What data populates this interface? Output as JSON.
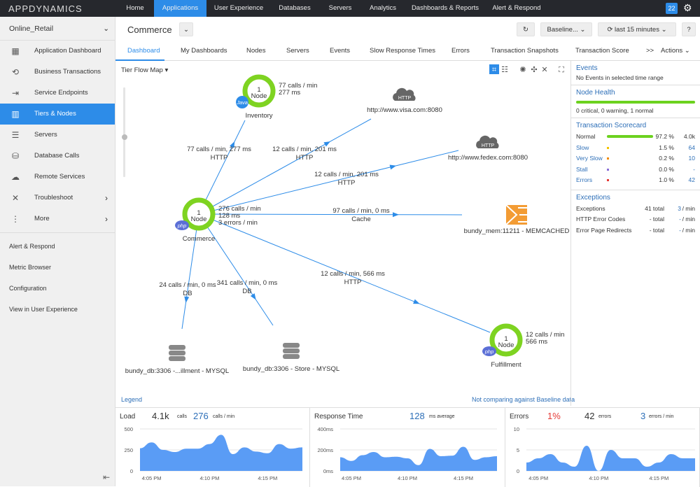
{
  "brand": "APPDYNAMICS",
  "topnav": {
    "items": [
      "Home",
      "Applications",
      "User Experience",
      "Databases",
      "Servers",
      "Analytics",
      "Dashboards & Reports",
      "Alert & Respond"
    ],
    "active": "Applications",
    "badge": "22",
    "accent": "#2d8ce8"
  },
  "sidebar": {
    "app": "Online_Retail",
    "items": [
      {
        "label": "Application Dashboard",
        "icon": "dashboard-icon"
      },
      {
        "label": "Business Transactions",
        "icon": "transactions-icon"
      },
      {
        "label": "Service Endpoints",
        "icon": "endpoint-icon"
      },
      {
        "label": "Tiers & Nodes",
        "icon": "tiers-icon",
        "active": true
      },
      {
        "label": "Servers",
        "icon": "servers-icon"
      },
      {
        "label": "Database Calls",
        "icon": "database-icon"
      },
      {
        "label": "Remote Services",
        "icon": "cloud-icon"
      },
      {
        "label": "Troubleshoot",
        "icon": "tools-icon"
      },
      {
        "label": "More",
        "icon": "more-icon"
      }
    ],
    "links": [
      "Alert & Respond",
      "Metric Browser",
      "Configuration",
      "View in User Experience"
    ]
  },
  "header": {
    "title": "Commerce",
    "baseline": "Baseline...",
    "timerange": "last 15 minutes",
    "help": "?"
  },
  "tabs": [
    "Dashboard",
    "My Dashboards",
    "Nodes",
    "Servers",
    "Events",
    "Slow Response Times",
    "Errors",
    "Transaction Snapshots",
    "Transaction Score"
  ],
  "tabs_more": ">>",
  "actions": "Actions",
  "map": {
    "view": "Tier Flow Map",
    "legend": "Legend",
    "baseline_note": "Not comparing against Baseline data",
    "tiers": [
      {
        "name": "Inventory",
        "count": "1",
        "unit": "Node",
        "agent": "Java",
        "stats": [
          "77 calls / min",
          "277 ms"
        ]
      },
      {
        "name": "Commerce",
        "count": "1",
        "unit": "Node",
        "agent": "php",
        "stats": [
          "276 calls / min",
          "128 ms",
          "3 errors / min"
        ]
      },
      {
        "name": "Fulfillment",
        "count": "1",
        "unit": "Node",
        "agent": "php",
        "stats": [
          "12 calls / min",
          "566 ms"
        ]
      }
    ],
    "backends": [
      {
        "name": "http://www.visa.com:8080",
        "type": "HTTP"
      },
      {
        "name": "http://www.fedex.com:8080",
        "type": "HTTP"
      },
      {
        "name": "bundy_mem:11211 - MEMCACHED",
        "type": "memcached"
      },
      {
        "name": "bundy_db:3306 -...illment - MYSQL",
        "type": "db"
      },
      {
        "name": "bundy_db:3306 - Store - MYSQL",
        "type": "db"
      }
    ],
    "edges": [
      {
        "label": "77 calls / min, 277 ms",
        "proto": "HTTP"
      },
      {
        "label": "12 calls / min, 201 ms",
        "proto": "HTTP"
      },
      {
        "label": "12 calls / min, 201 ms",
        "proto": "HTTP"
      },
      {
        "label": "97 calls / min, 0 ms",
        "proto": "Cache"
      },
      {
        "label": "12 calls / min, 566 ms",
        "proto": "HTTP"
      },
      {
        "label": "24 calls / min, 0 ms",
        "proto": "DB"
      },
      {
        "label": "341 calls / min, 0 ms",
        "proto": "DB"
      }
    ]
  },
  "right": {
    "events": {
      "title": "Events",
      "text": "No Events in selected time range"
    },
    "health": {
      "title": "Node Health",
      "text": "0 critical, 0 warning, 1 normal",
      "normal_fraction": 1.0
    },
    "scorecard": {
      "title": "Transaction Scorecard",
      "rows": [
        {
          "label": "Normal",
          "pct": "97.2 %",
          "count": "4.0k",
          "color": "#6cd21f"
        },
        {
          "label": "Slow",
          "pct": "1.5 %",
          "count": "64",
          "color": "#f5c400"
        },
        {
          "label": "Very Slow",
          "pct": "0.2 %",
          "count": "10",
          "color": "#f08c00"
        },
        {
          "label": "Stall",
          "pct": "0.0 %",
          "count": "-",
          "color": "#8a6fd6"
        },
        {
          "label": "Errors",
          "pct": "1.0 %",
          "count": "42",
          "color": "#e53935"
        }
      ]
    },
    "exceptions": {
      "title": "Exceptions",
      "rows": [
        {
          "label": "Exceptions",
          "total": "41 total",
          "rate": "3",
          "unit": "/ min"
        },
        {
          "label": "HTTP Error Codes",
          "total": "- total",
          "rate": "-",
          "unit": "/ min"
        },
        {
          "label": "Error Page Redirects",
          "total": "- total",
          "rate": "-",
          "unit": "/ min"
        }
      ]
    }
  },
  "chart_data": [
    {
      "type": "area",
      "title": "Load",
      "summary": [
        {
          "v": "4.1k",
          "u": "calls"
        },
        {
          "v": "276",
          "u": "calls / min"
        }
      ],
      "x": [
        "4:04",
        "4:05",
        "4:06",
        "4:07",
        "4:08",
        "4:09",
        "4:10",
        "4:11",
        "4:12",
        "4:13",
        "4:14",
        "4:15",
        "4:16",
        "4:17",
        "4:18"
      ],
      "xticks": [
        "4:05 PM",
        "4:10 PM",
        "4:15 PM"
      ],
      "yticks": [
        "0",
        "250",
        "500"
      ],
      "ylim": [
        0,
        500
      ],
      "values": [
        270,
        340,
        250,
        225,
        265,
        265,
        320,
        430,
        200,
        280,
        230,
        210,
        320,
        265,
        280
      ]
    },
    {
      "type": "area",
      "title": "Response Time",
      "summary": [
        {
          "v": "128",
          "u": "ms average"
        }
      ],
      "x": [
        "4:04",
        "4:05",
        "4:06",
        "4:07",
        "4:08",
        "4:09",
        "4:10",
        "4:11",
        "4:12",
        "4:13",
        "4:14",
        "4:15",
        "4:16",
        "4:17",
        "4:18"
      ],
      "xticks": [
        "4:05 PM",
        "4:10 PM",
        "4:15 PM"
      ],
      "yticks": [
        "0ms",
        "200ms",
        "400ms"
      ],
      "ylim": [
        0,
        400
      ],
      "values": [
        130,
        95,
        150,
        180,
        130,
        135,
        120,
        55,
        210,
        140,
        145,
        230,
        105,
        130,
        140
      ]
    },
    {
      "type": "area",
      "title": "Errors",
      "summary": [
        {
          "v": "1%",
          "u": ""
        },
        {
          "v": "42",
          "u": "errors"
        },
        {
          "v": "3",
          "u": "errors / min"
        }
      ],
      "x": [
        "4:04",
        "4:05",
        "4:06",
        "4:07",
        "4:08",
        "4:09",
        "4:10",
        "4:11",
        "4:12",
        "4:13",
        "4:14",
        "4:15",
        "4:16",
        "4:17",
        "4:18"
      ],
      "xticks": [
        "4:05 PM",
        "4:10 PM",
        "4:15 PM"
      ],
      "yticks": [
        "0",
        "5",
        "10"
      ],
      "ylim": [
        0,
        10
      ],
      "values": [
        2,
        3,
        4,
        2,
        1,
        6,
        0,
        5,
        3,
        3,
        1,
        2,
        4,
        3,
        3
      ]
    }
  ]
}
